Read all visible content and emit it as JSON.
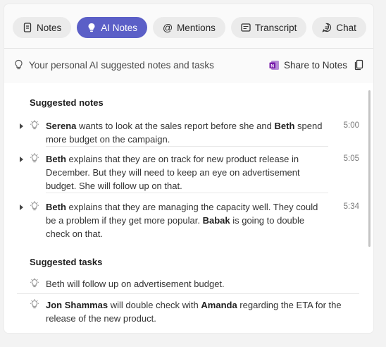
{
  "tabs": [
    {
      "label": "Notes",
      "icon": "notes-icon",
      "active": false
    },
    {
      "label": "AI Notes",
      "icon": "bulb-icon",
      "active": true
    },
    {
      "label": "Mentions",
      "icon": "at-icon",
      "active": false
    },
    {
      "label": "Transcript",
      "icon": "transcript-icon",
      "active": false
    },
    {
      "label": "Chat",
      "icon": "chat-icon",
      "active": false
    }
  ],
  "infobar": {
    "text": "Your personal AI suggested notes and tasks",
    "share_label": "Share to Notes"
  },
  "suggested_notes": {
    "heading": "Suggested notes",
    "items": [
      {
        "parts": [
          {
            "t": "Serena",
            "b": true
          },
          {
            "t": " wants to look at the sales report before she and ",
            "b": false
          },
          {
            "t": "Beth",
            "b": true
          },
          {
            "t": " spend more budget on the campaign.",
            "b": false
          }
        ],
        "time": "5:00"
      },
      {
        "parts": [
          {
            "t": "Beth",
            "b": true
          },
          {
            "t": " explains that they are on track for new product release in December. But they will need to keep an eye on advertisement budget. She will follow up on that.",
            "b": false
          }
        ],
        "time": "5:05"
      },
      {
        "parts": [
          {
            "t": "Beth",
            "b": true
          },
          {
            "t": " explains that they are managing the capacity well. They could be a problem if they get more popular. ",
            "b": false
          },
          {
            "t": "Babak",
            "b": true
          },
          {
            "t": " is going to double check on that.",
            "b": false
          }
        ],
        "time": "5:34"
      }
    ]
  },
  "suggested_tasks": {
    "heading": "Suggested tasks",
    "items": [
      {
        "parts": [
          {
            "t": "Beth will follow up on advertisement budget.",
            "b": false
          }
        ]
      },
      {
        "parts": [
          {
            "t": "Jon Shammas",
            "b": true
          },
          {
            "t": " will double check with ",
            "b": false
          },
          {
            "t": "Amanda",
            "b": true
          },
          {
            "t": " regarding the ETA for the release of the new product.",
            "b": false
          }
        ]
      }
    ]
  },
  "colors": {
    "accent": "#5b5fc7",
    "onenote": "#7719aa"
  }
}
